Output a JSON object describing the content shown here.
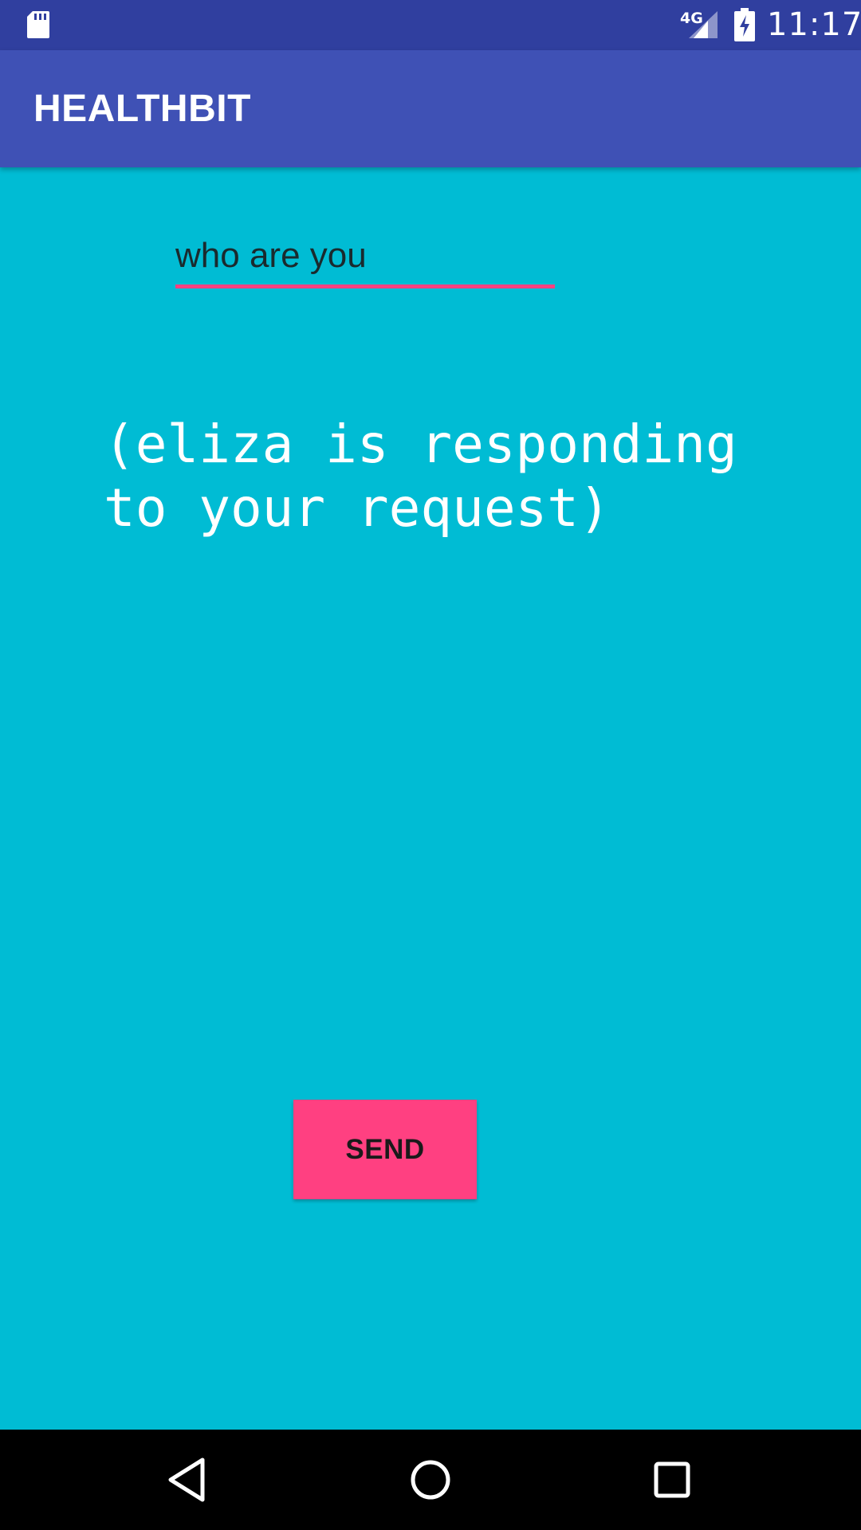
{
  "status_bar": {
    "time": "11:17",
    "network": "4G",
    "icons": [
      "sd-card-icon",
      "signal-icon",
      "battery-charging-icon"
    ]
  },
  "app_bar": {
    "title": "HEALTHBIT"
  },
  "chat": {
    "input_value": "who are you",
    "response": "(eliza is responding\nto your request)",
    "send_label": "SEND"
  },
  "nav_bar": {
    "icons": [
      "back-icon",
      "home-icon",
      "recents-icon"
    ]
  },
  "colors": {
    "status_bar": "#303F9F",
    "app_bar": "#3F51B5",
    "background": "#00BCD4",
    "accent": "#FF4081"
  }
}
